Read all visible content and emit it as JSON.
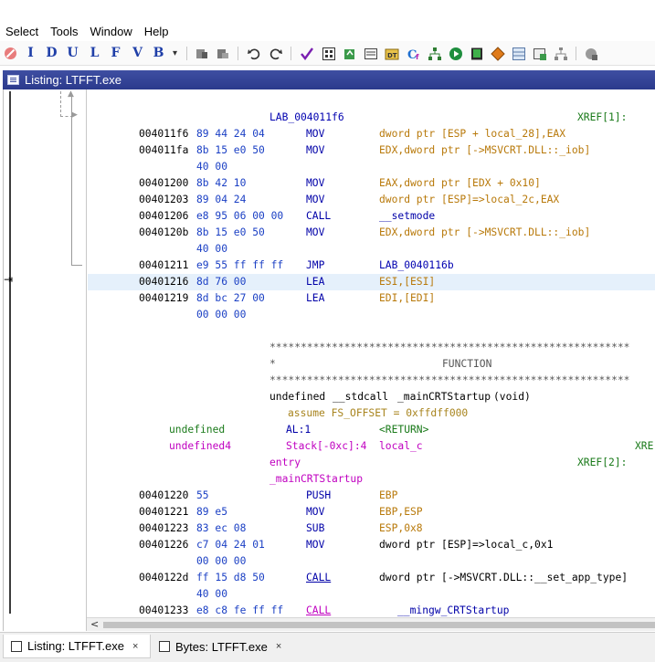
{
  "menu": {
    "items": [
      "Select",
      "Tools",
      "Window",
      "Help"
    ]
  },
  "toolbar": {
    "letters": [
      "I",
      "D",
      "U",
      "L",
      "F",
      "V",
      "B"
    ],
    "dropdown_glyph": "▾"
  },
  "listing": {
    "title": "Listing:  LTFFT.exe"
  },
  "code": {
    "label_top": "LAB_004011f6",
    "xref_top": "XREF[1]:",
    "rows": [
      {
        "addr": "004011f6",
        "bytes": "89 44 24 04",
        "mn": "MOV",
        "op": "dword ptr [ESP + local_28],EAX"
      },
      {
        "addr": "004011fa",
        "bytes": "8b 15 e0 50",
        "mn": "MOV",
        "op": "EDX,dword ptr [->MSVCRT.DLL::_iob]"
      },
      {
        "addr": "",
        "bytes": "40 00",
        "mn": "",
        "op": ""
      },
      {
        "addr": "00401200",
        "bytes": "8b 42 10",
        "mn": "MOV",
        "op": "EAX,dword ptr [EDX + 0x10]"
      },
      {
        "addr": "00401203",
        "bytes": "89 04 24",
        "mn": "MOV",
        "op": "dword ptr [ESP]=>local_2c,EAX"
      },
      {
        "addr": "00401206",
        "bytes": "e8 95 06 00 00",
        "mn": "CALL",
        "op": "__setmode"
      },
      {
        "addr": "0040120b",
        "bytes": "8b 15 e0 50",
        "mn": "MOV",
        "op": "EDX,dword ptr [->MSVCRT.DLL::_iob]"
      },
      {
        "addr": "",
        "bytes": "40 00",
        "mn": "",
        "op": ""
      },
      {
        "addr": "00401211",
        "bytes": "e9 55 ff ff ff",
        "mn": "JMP",
        "op": "LAB_0040116b"
      },
      {
        "addr": "00401216",
        "bytes": "8d 76 00",
        "mn": "LEA",
        "op": "ESI,[ESI]"
      },
      {
        "addr": "00401219",
        "bytes": "8d bc 27 00",
        "mn": "LEA",
        "op": "EDI,[EDI]"
      },
      {
        "addr": "",
        "bytes": "00 00 00",
        "mn": "",
        "op": ""
      }
    ],
    "stars": "**********************************************************",
    "star_single": "*",
    "function_word": "FUNCTION",
    "signature": {
      "ret_type": "undefined",
      "callconv": "__stdcall",
      "name": "_mainCRTStartup",
      "params": "(void)"
    },
    "assume": "assume FS_OFFSET = 0xffdff000",
    "var1": {
      "type": "undefined",
      "storage": "AL:1",
      "name": "<RETURN>"
    },
    "var2": {
      "type": "undefined4",
      "storage": "Stack[-0xc]:4",
      "name": "local_c",
      "xref": "XRE"
    },
    "entry": "entry",
    "entry_xref": "XREF[2]:",
    "func_label": "_mainCRTStartup",
    "rows2": [
      {
        "addr": "00401220",
        "bytes": "55",
        "mn": "PUSH",
        "op": "EBP"
      },
      {
        "addr": "00401221",
        "bytes": "89 e5",
        "mn": "MOV",
        "op": "EBP,ESP"
      },
      {
        "addr": "00401223",
        "bytes": "83 ec 08",
        "mn": "SUB",
        "op": "ESP,0x8"
      },
      {
        "addr": "00401226",
        "bytes": "c7 04 24 01",
        "mn": "MOV",
        "op": "dword ptr [ESP]=>local_c,0x1"
      },
      {
        "addr": "",
        "bytes": "00 00 00",
        "mn": "",
        "op": ""
      },
      {
        "addr": "0040122d",
        "bytes": "ff 15 d8 50",
        "mn": "CALL",
        "op": "dword ptr [->MSVCRT.DLL::__set_app_type]"
      },
      {
        "addr": "",
        "bytes": "40 00",
        "mn": "",
        "op": ""
      },
      {
        "addr": "00401233",
        "bytes": "e8 c8 fe ff ff",
        "mn": "CALL",
        "op": "__mingw_CRTStartup"
      }
    ]
  },
  "tabs": [
    {
      "label": "Listing:  LTFFT.exe",
      "close": "×"
    },
    {
      "label": "Bytes: LTFFT.exe",
      "close": "×"
    }
  ],
  "scroll": {
    "left_arrow": "<"
  }
}
